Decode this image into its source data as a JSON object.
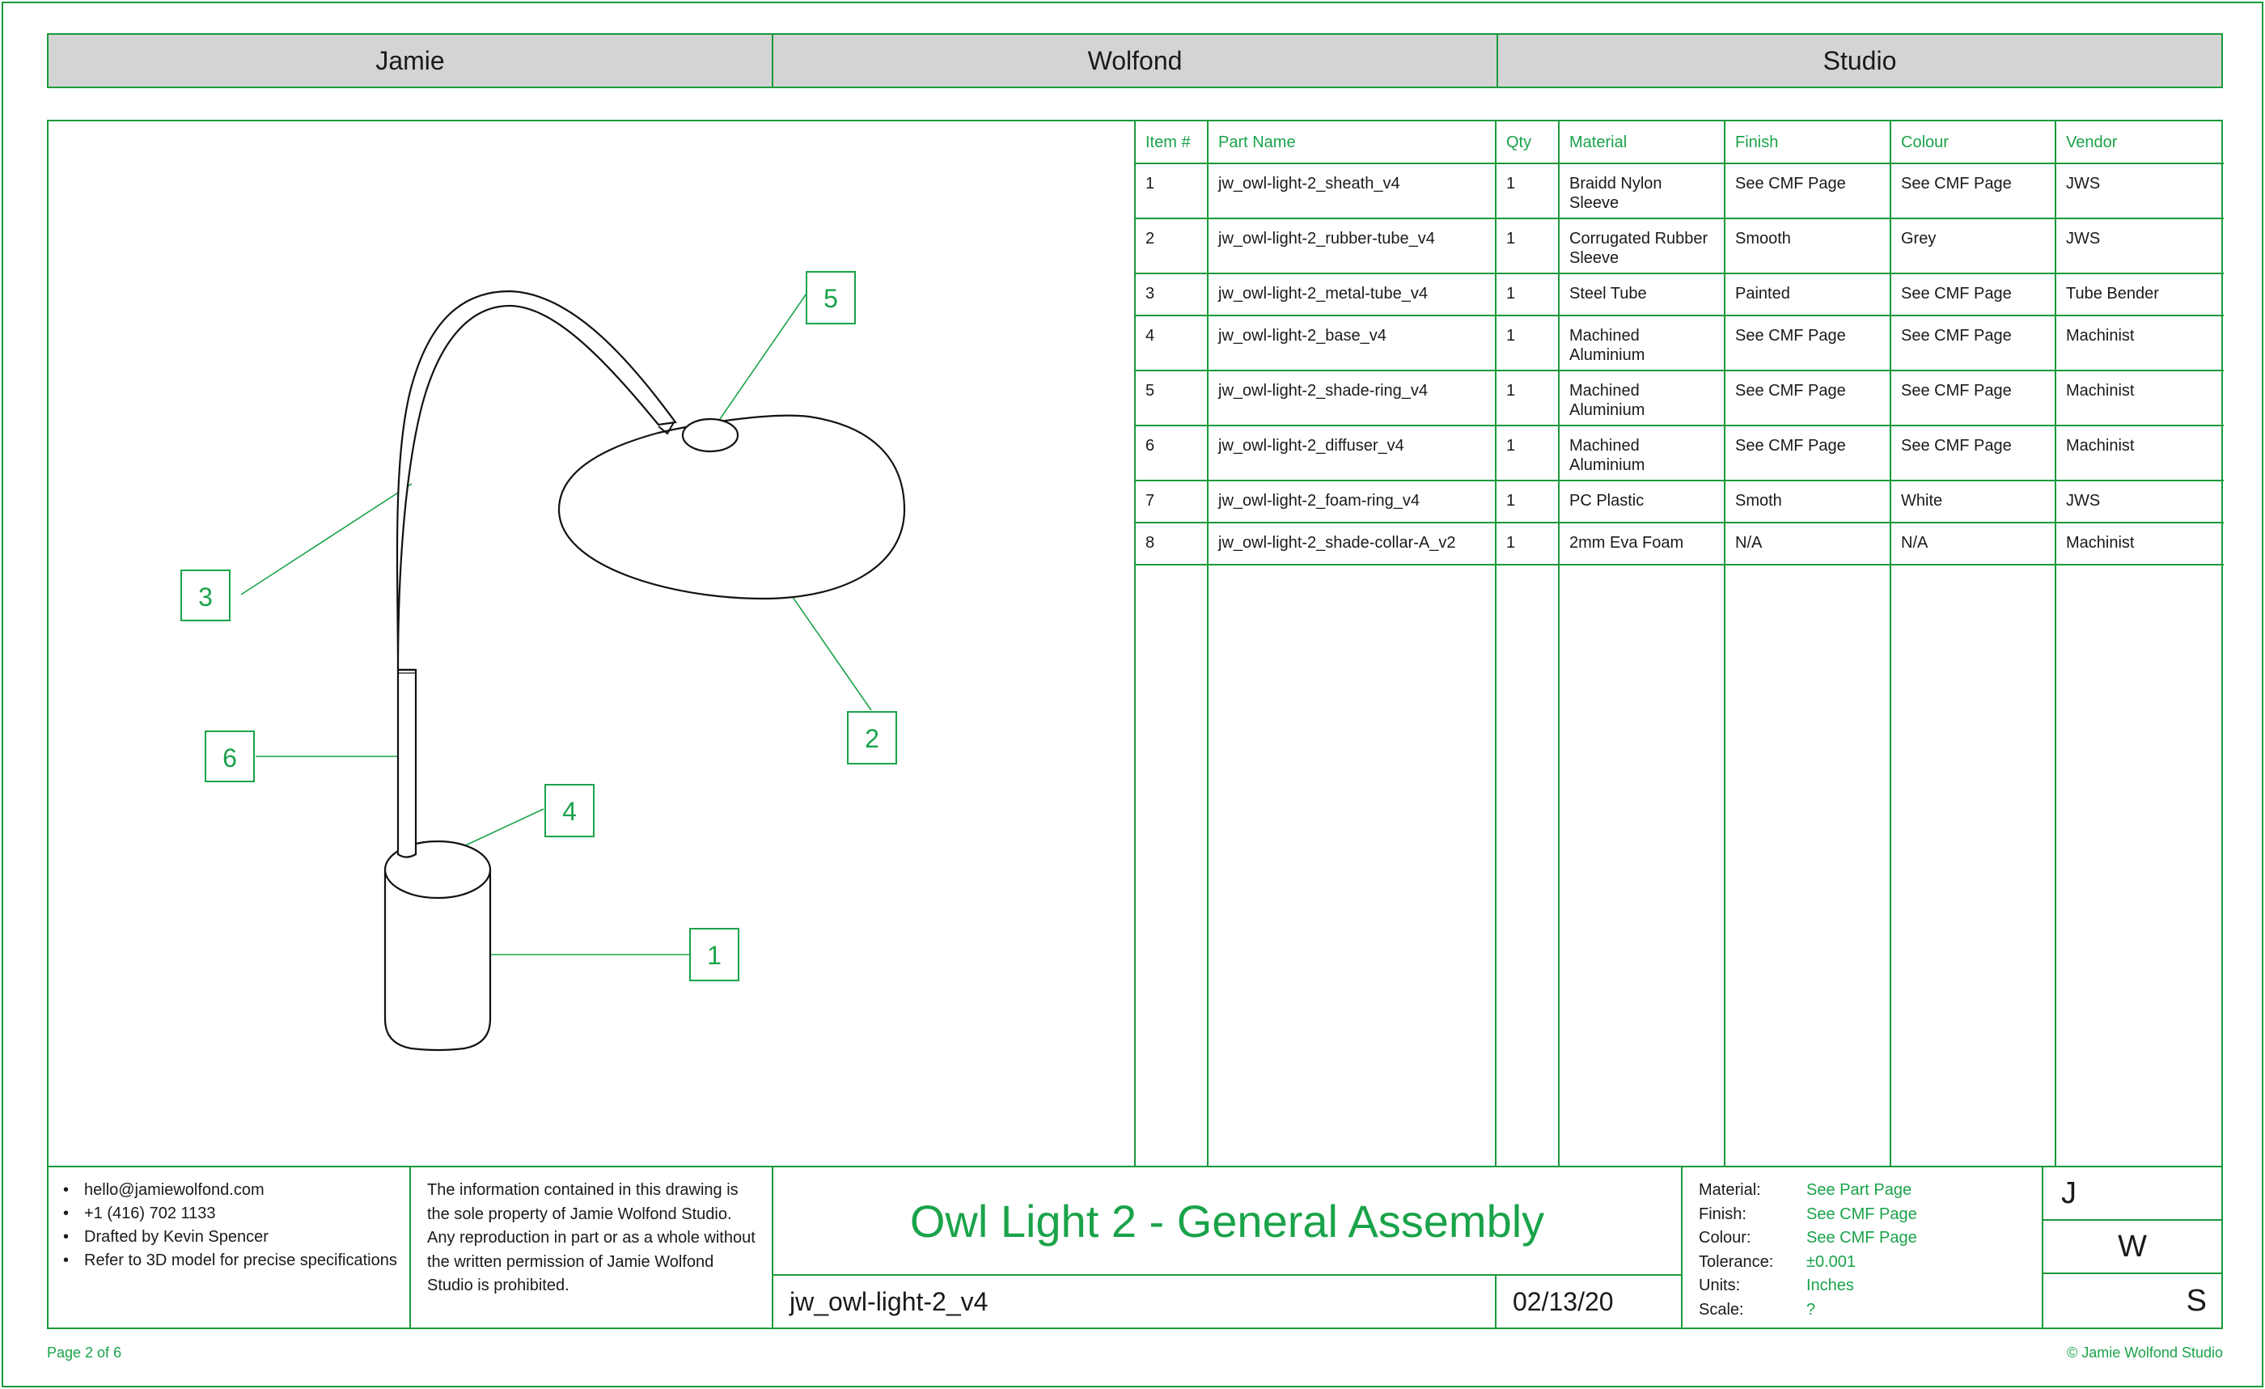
{
  "header": {
    "cells": [
      "Jamie",
      "Wolfond",
      "Studio"
    ]
  },
  "callouts": [
    "1",
    "2",
    "3",
    "4",
    "5",
    "6"
  ],
  "bom": {
    "columns": [
      "Item #",
      "Part Name",
      "Qty",
      "Material",
      "Finish",
      "Colour",
      "Vendor"
    ],
    "rows": [
      [
        "1",
        "jw_owl-light-2_sheath_v4",
        "1",
        "Braidd Nylon Sleeve",
        "See CMF Page",
        "See CMF Page",
        "JWS"
      ],
      [
        "2",
        "jw_owl-light-2_rubber-tube_v4",
        "1",
        "Corrugated Rubber Sleeve",
        "Smooth",
        "Grey",
        "JWS"
      ],
      [
        "3",
        "jw_owl-light-2_metal-tube_v4",
        "1",
        "Steel Tube",
        "Painted",
        "See CMF Page",
        "Tube Bender"
      ],
      [
        "4",
        "jw_owl-light-2_base_v4",
        "1",
        "Machined Aluminium",
        "See CMF Page",
        "See CMF Page",
        "Machinist"
      ],
      [
        "5",
        "jw_owl-light-2_shade-ring_v4",
        "1",
        "Machined Aluminium",
        "See CMF Page",
        "See CMF Page",
        "Machinist"
      ],
      [
        "6",
        "jw_owl-light-2_diffuser_v4",
        "1",
        "Machined Aluminium",
        "See CMF Page",
        "See CMF Page",
        "Machinist"
      ],
      [
        "7",
        "jw_owl-light-2_foam-ring_v4",
        "1",
        "PC Plastic",
        "Smoth",
        "White",
        "JWS"
      ],
      [
        "8",
        "jw_owl-light-2_shade-collar-A_v2",
        "1",
        "2mm Eva Foam",
        "N/A",
        "N/A",
        "Machinist"
      ]
    ]
  },
  "titleblock": {
    "contact": [
      "hello@jamiewolfond.com",
      "+1 (416) 702 1133",
      "Drafted by Kevin Spencer",
      "Refer to 3D model for precise specifications"
    ],
    "notice": "The information contained in this drawing is the sole property of Jamie Wolfond Studio. Any reproduction in part or as a whole without the written permission of Jamie Wolfond Studio is prohibited.",
    "title": "Owl Light 2 - General Assembly",
    "part_number": "jw_owl-light-2_v4",
    "date": "02/13/20",
    "specs": [
      {
        "label": "Material:",
        "value": "See Part Page"
      },
      {
        "label": "Finish:",
        "value": "See CMF Page"
      },
      {
        "label": "Colour:",
        "value": "See CMF Page"
      },
      {
        "label": "Tolerance:",
        "value": "±0.001"
      },
      {
        "label": "Units:",
        "value": "Inches"
      },
      {
        "label": "Scale:",
        "value": "?"
      }
    ],
    "logo": [
      "J",
      "W",
      "S"
    ]
  },
  "footer": {
    "page": "Page 2 of 6",
    "copyright": "© Jamie Wolfond Studio"
  }
}
